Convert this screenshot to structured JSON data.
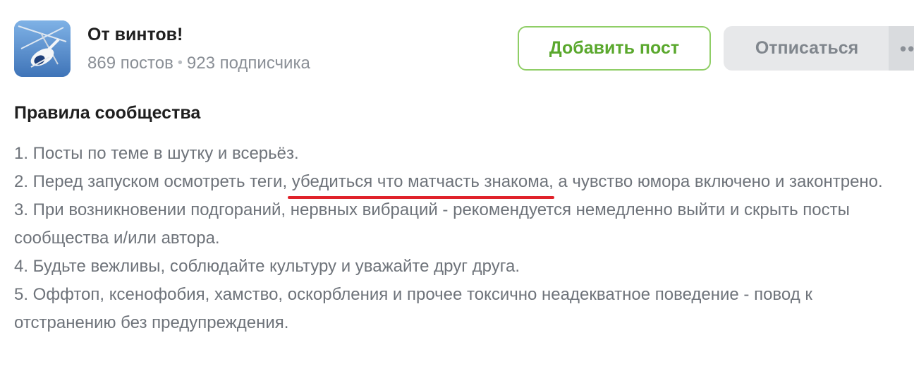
{
  "community": {
    "name": "От винтов!",
    "posts": "869 постов",
    "separator": "•",
    "subscribers": "923 подписчика"
  },
  "actions": {
    "add_post_label": "Добавить пост",
    "unsubscribe_label": "Отписаться",
    "more_label": "••"
  },
  "rules": {
    "heading": "Правила сообщества",
    "items": [
      {
        "text": "1. Посты по теме в шутку и всерьёз."
      },
      {
        "before": "2. Перед запуском осмотреть теги,",
        "highlight": "убедиться что матчасть знакома",
        "after": ", а чувство юмора включено и законтрено."
      },
      {
        "text": "3. При возникновении подгораний, нервных вибраций - рекомендуется немедленно выйти и скрыть посты сообщества и/или автора."
      },
      {
        "text": "4. Будьте вежливы, соблюдайте культуру и уважайте друг друга."
      },
      {
        "text": "5. Оффтоп, ксенофобия, хамство, оскорбления и прочее токсично неадекватное поведение - повод к отстранению без предупреждения."
      }
    ]
  },
  "colors": {
    "accent_green": "#5aa82d",
    "underline_red": "#e0222a",
    "avatar_sky": "#4f86c6"
  },
  "icons": {
    "avatar": "helicopter-image"
  }
}
